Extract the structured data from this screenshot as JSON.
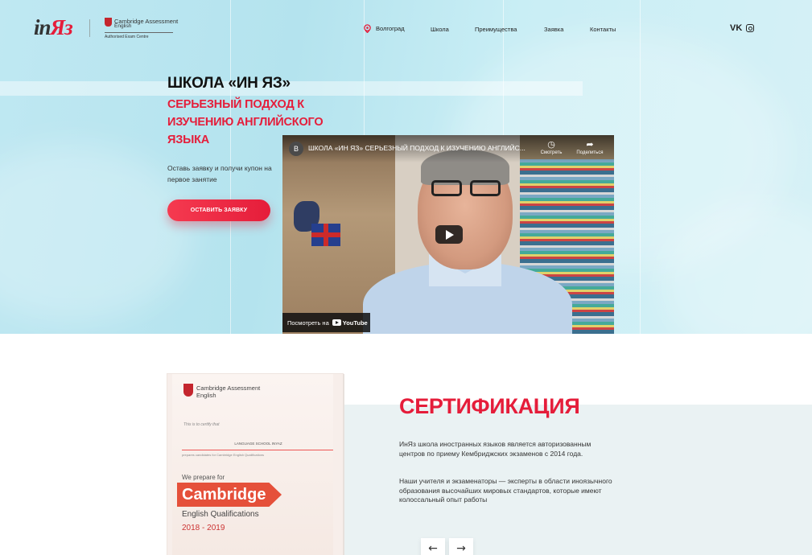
{
  "header": {
    "logo_in": "in",
    "logo_ya": "Яз",
    "partner_line1": "Cambridge Assessment",
    "partner_line2": "English",
    "partner_line3": "Authorised Exam Centre",
    "city": "Волгоград",
    "nav": [
      "Школа",
      "Преимущества",
      "Заявка",
      "Контакты"
    ],
    "social_vk": "VK",
    "social_icons": [
      "vk-icon",
      "instagram-icon"
    ]
  },
  "hero": {
    "title": "ШКОЛА «ИН ЯЗ»",
    "subtitle": "СЕРЬЕЗНЫЙ ПОДХОД К ИЗУЧЕНИЮ АНГЛИЙСКОГО ЯЗЫКА",
    "lead": "Оставь заявку и получи купон на первое занятие",
    "cta": "ОСТАВИТЬ ЗАЯВКУ"
  },
  "video": {
    "channel_initial": "В",
    "title": "ШКОЛА «ИН ЯЗ» СЕРЬЕЗНЫЙ ПОДХОД К ИЗУЧЕНИЮ АНГЛИЙС...",
    "watch_later": "Смотреть",
    "share": "Поделиться",
    "watch_on": "Посмотреть на",
    "youtube": "YouTube"
  },
  "certification": {
    "heading": "СЕРТИФИКАЦИЯ",
    "paragraph1": "ИнЯз школа иностранных языков является авторизованным центров по приему Кембриджских экзаменов с 2014 года.",
    "paragraph2": "Наши учителя и экзаменаторы — эксперты в области иноязычного образования высочайших мировых стандартов, которые имеют колоссальный опыт работы",
    "doc": {
      "brand1": "Cambridge Assessment",
      "brand2": "English",
      "certify": "This is to certify that",
      "school": "LANGUAGE SCHOOL INYAZ",
      "prepares": "prepares candidates for Cambridge English Qualifications",
      "we_prepare": "We prepare for",
      "badge": "Cambridge",
      "qualifications": "English Qualifications",
      "years": "2018 - 2019"
    },
    "prev": "←",
    "next": "→"
  },
  "colors": {
    "accent": "#e51d3a",
    "hero_bg": "#bfe8f2"
  }
}
